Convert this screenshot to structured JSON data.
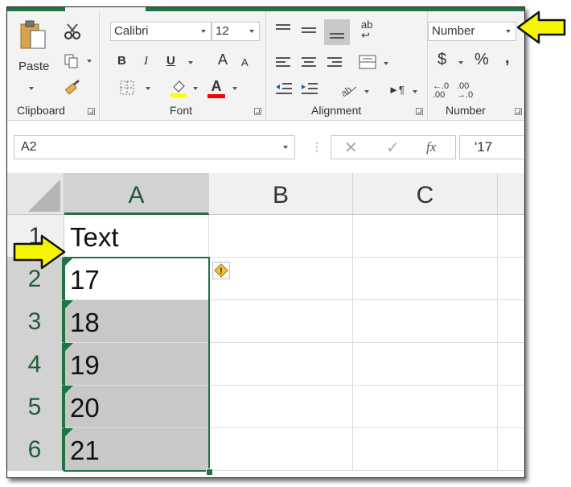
{
  "ribbon": {
    "clipboard": {
      "label": "Clipboard",
      "paste_label": "Paste"
    },
    "font": {
      "label": "Font",
      "font_name": "Calibri",
      "font_size": "12",
      "bold": "B",
      "italic": "I",
      "underline": "U",
      "grow": "A",
      "shrink": "A",
      "fill_color": "#ffff00",
      "font_color": "#ff0000"
    },
    "alignment": {
      "label": "Alignment",
      "wrap": "ab"
    },
    "number": {
      "label": "Number",
      "format": "Number",
      "currency": "$",
      "percent": "%",
      "comma": ",",
      "inc_decimal": "←.0 .00",
      "dec_decimal": ".00 →.0"
    }
  },
  "formula_bar": {
    "name_box": "A2",
    "fx_label": "fx",
    "content": "'17"
  },
  "grid": {
    "columns": [
      "A",
      "B",
      "C"
    ],
    "rows": [
      {
        "num": "1",
        "a": "Text"
      },
      {
        "num": "2",
        "a": "17"
      },
      {
        "num": "3",
        "a": "18"
      },
      {
        "num": "4",
        "a": "19"
      },
      {
        "num": "5",
        "a": "20"
      },
      {
        "num": "6",
        "a": "21"
      }
    ],
    "selected_column": "A",
    "error_icon": "!"
  },
  "colors": {
    "excel_green": "#217346",
    "callout_arrow": "#f5f500",
    "error_triangle": "#107c41"
  }
}
